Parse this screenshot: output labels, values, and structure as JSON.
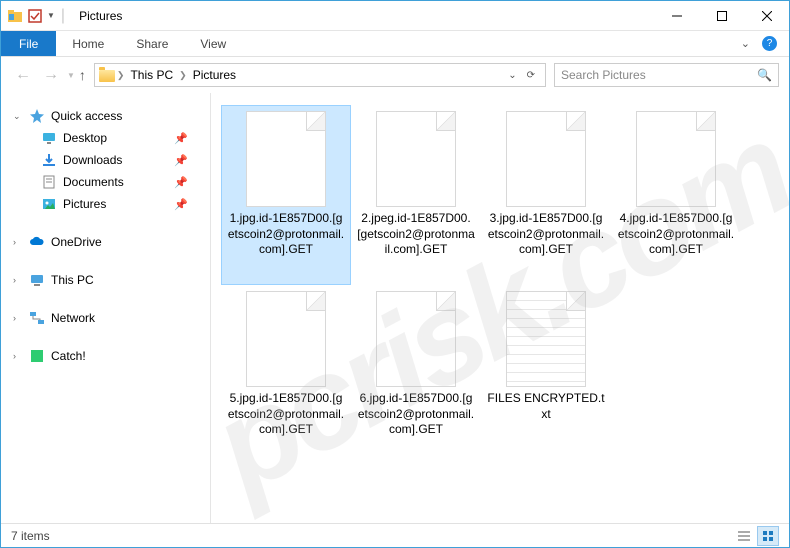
{
  "title": "Pictures",
  "ribbon": {
    "file": "File",
    "home": "Home",
    "share": "Share",
    "view": "View"
  },
  "breadcrumb": {
    "pc": "This PC",
    "folder": "Pictures"
  },
  "search": {
    "placeholder": "Search Pictures"
  },
  "sidebar": {
    "quick": "Quick access",
    "quick_items": [
      {
        "label": "Desktop"
      },
      {
        "label": "Downloads"
      },
      {
        "label": "Documents"
      },
      {
        "label": "Pictures"
      }
    ],
    "onedrive": "OneDrive",
    "thispc": "This PC",
    "network": "Network",
    "catch": "Catch!"
  },
  "files": [
    {
      "name": "1.jpg.id-1E857D00.[getscoin2@protonmail.com].GET",
      "selected": true,
      "type": "generic"
    },
    {
      "name": "2.jpeg.id-1E857D00.[getscoin2@protonmail.com].GET",
      "selected": false,
      "type": "generic"
    },
    {
      "name": "3.jpg.id-1E857D00.[getscoin2@protonmail.com].GET",
      "selected": false,
      "type": "generic"
    },
    {
      "name": "4.jpg.id-1E857D00.[getscoin2@protonmail.com].GET",
      "selected": false,
      "type": "generic"
    },
    {
      "name": "5.jpg.id-1E857D00.[getscoin2@protonmail.com].GET",
      "selected": false,
      "type": "generic"
    },
    {
      "name": "6.jpg.id-1E857D00.[getscoin2@protonmail.com].GET",
      "selected": false,
      "type": "generic"
    },
    {
      "name": "FILES ENCRYPTED.txt",
      "selected": false,
      "type": "txt"
    }
  ],
  "status": {
    "count": "7 items"
  },
  "watermark": "pcrisk.com"
}
